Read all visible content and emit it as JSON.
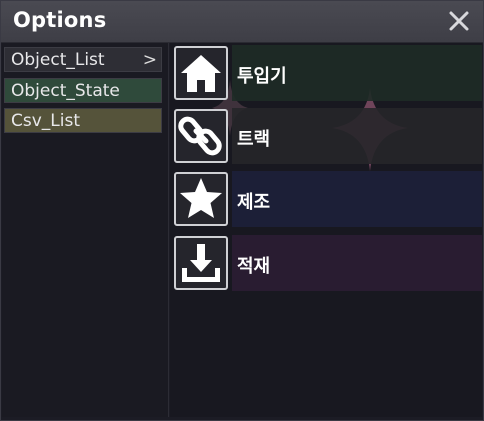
{
  "window": {
    "title": "Options"
  },
  "sidebar": {
    "items": [
      {
        "label": "Object_List",
        "has_arrow": true,
        "bg": "#2e2e35"
      },
      {
        "label": "Object_State",
        "has_arrow": false,
        "bg": "#2f4a3b"
      },
      {
        "label": "Csv_List",
        "has_arrow": false,
        "bg": "#55533a"
      }
    ],
    "arrow_glyph": ">"
  },
  "actions": [
    {
      "label": "투입기",
      "icon": "home-icon",
      "bg": "#1e2b26"
    },
    {
      "label": "트랙",
      "icon": "link-icon",
      "bg": "#262629"
    },
    {
      "label": "제조",
      "icon": "star-icon",
      "bg": "#1d203a"
    },
    {
      "label": "적재",
      "icon": "download-icon",
      "bg": "#2b1d33"
    }
  ],
  "colors": {
    "title_bar": "#444450",
    "panel_bg": "#1c1c25",
    "text": "#ffffff",
    "sparkle": "#b86a8a"
  }
}
